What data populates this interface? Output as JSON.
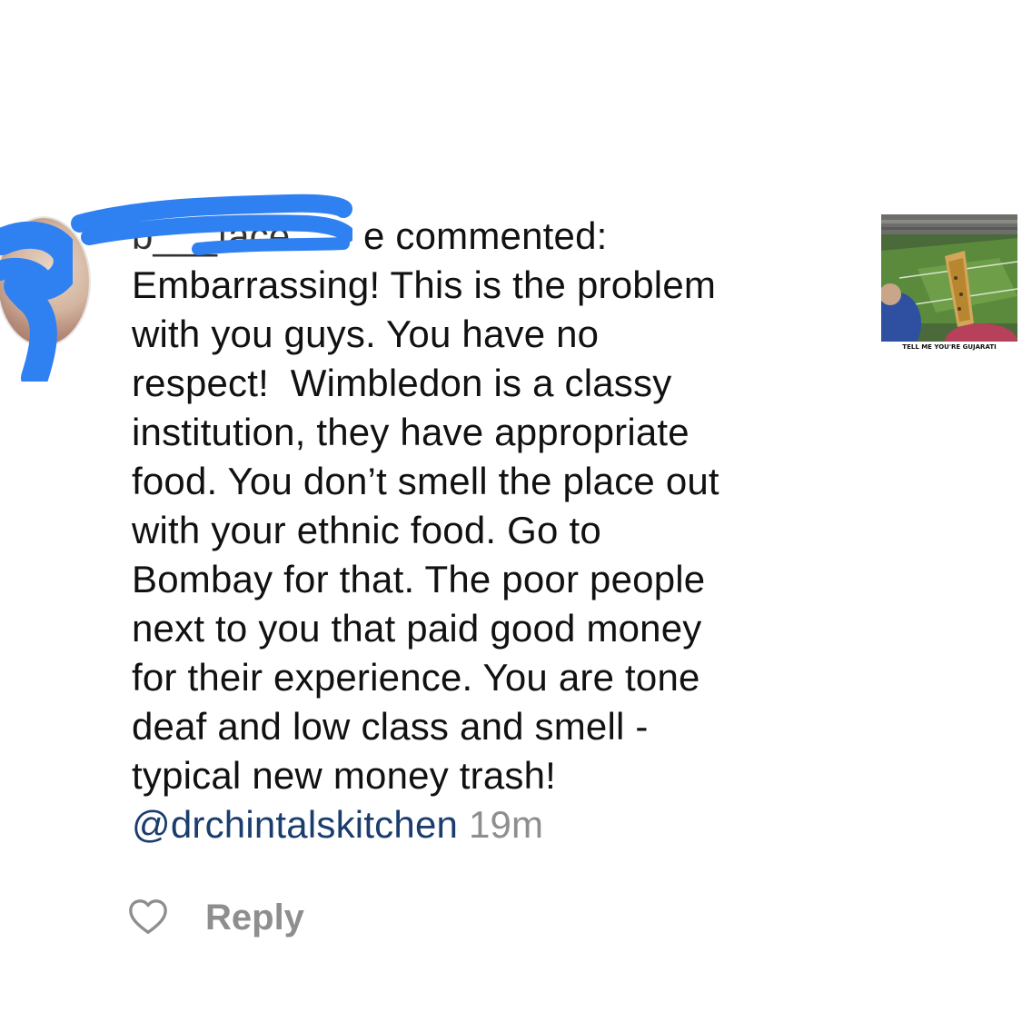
{
  "comment": {
    "username": "b___face",
    "action": "e commented:",
    "lines": [
      "Embarrassing! This is the problem",
      "with you guys. You have no",
      "respect!  Wimbledon is a classy",
      "institution, they have appropriate",
      "food. You don’t smell the place out",
      "with your ethnic food. Go to",
      "Bombay for that. The poor people",
      "next to you that paid good money",
      "for their experience. You are tone",
      "deaf and low class and smell -",
      "typical new money trash!"
    ],
    "mention": "@drchintalskitchen",
    "timestamp": "19m"
  },
  "thumbnail": {
    "caption": "TELL ME YOU'RE GUJARATI"
  },
  "actions": {
    "like_icon": "heart-outline-icon",
    "reply_label": "Reply"
  },
  "colors": {
    "mention": "#1b3d6d",
    "muted": "#8e8e8e",
    "redaction": "#2f80f0"
  }
}
